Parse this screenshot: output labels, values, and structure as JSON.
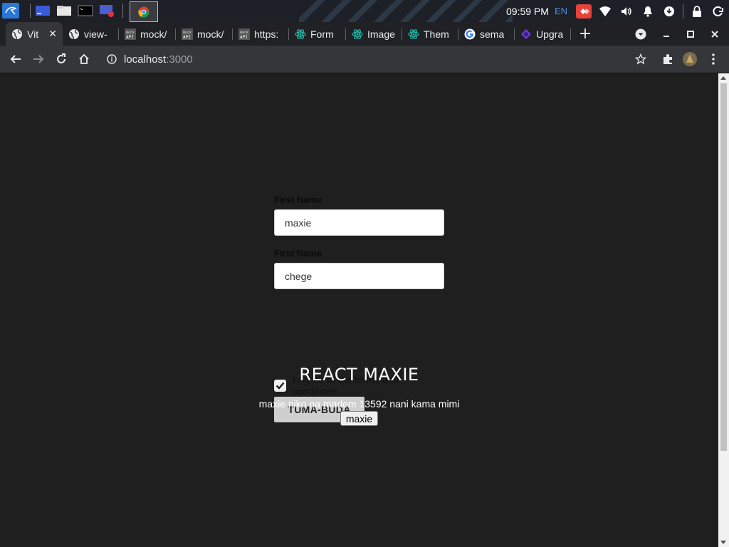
{
  "taskbar": {
    "clock": "09:59 PM",
    "language": "EN"
  },
  "tabs": [
    {
      "label": "Vit",
      "icon": "globe-icon",
      "active": true
    },
    {
      "label": "view-",
      "icon": "globe-icon"
    },
    {
      "label": "mock/",
      "icon": "mockapi-icon"
    },
    {
      "label": "mock/",
      "icon": "mockapi-icon"
    },
    {
      "label": "https:",
      "icon": "mockapi-icon"
    },
    {
      "label": "Form",
      "icon": "react-icon"
    },
    {
      "label": "Image",
      "icon": "react-icon"
    },
    {
      "label": "Them",
      "icon": "react-icon"
    },
    {
      "label": "sema",
      "icon": "google-icon"
    },
    {
      "label": "Upgra",
      "icon": "semantic-icon"
    }
  ],
  "address_bar": {
    "host": "localhost",
    "port": ":3000"
  },
  "form": {
    "first_name_label": "First Name",
    "first_name_value": "maxie",
    "second_name_label": "First Name",
    "second_name_value": "chege",
    "agree_label": "I Agree to the terms and conditions",
    "agree_checked": true,
    "submit_label": "TUMA-BUDA"
  },
  "content": {
    "heading": "REACT MAXIE",
    "message": "maxie niko na madem 13592 nani kama mimi",
    "button_label": "maxie"
  },
  "colors": {
    "page_bg": "#1f1f1f",
    "accent_blue": "#4a8fe0"
  }
}
